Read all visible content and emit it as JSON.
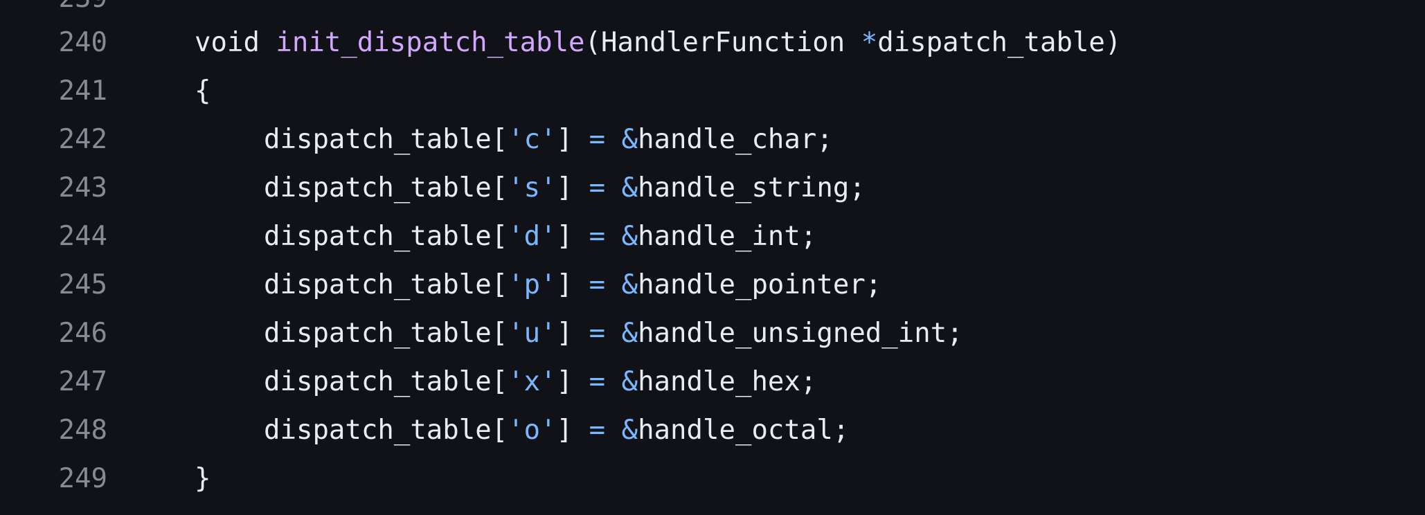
{
  "partial_top_line": "239",
  "lines": [
    {
      "num": "240",
      "parts": [
        "void",
        " ",
        "init_dispatch_table",
        "(HandlerFunction ",
        "*",
        "dispatch_table)"
      ]
    },
    {
      "num": "241",
      "parts": [
        "{"
      ]
    },
    {
      "num": "242",
      "parts": [
        "dispatch_table[",
        "'c'",
        "] ",
        "=",
        " ",
        "&",
        "handle_char;"
      ]
    },
    {
      "num": "243",
      "parts": [
        "dispatch_table[",
        "'s'",
        "] ",
        "=",
        " ",
        "&",
        "handle_string;"
      ]
    },
    {
      "num": "244",
      "parts": [
        "dispatch_table[",
        "'d'",
        "] ",
        "=",
        " ",
        "&",
        "handle_int;"
      ]
    },
    {
      "num": "245",
      "parts": [
        "dispatch_table[",
        "'p'",
        "] ",
        "=",
        " ",
        "&",
        "handle_pointer;"
      ]
    },
    {
      "num": "246",
      "parts": [
        "dispatch_table[",
        "'u'",
        "] ",
        "=",
        " ",
        "&",
        "handle_unsigned_int;"
      ]
    },
    {
      "num": "247",
      "parts": [
        "dispatch_table[",
        "'x'",
        "] ",
        "=",
        " ",
        "&",
        "handle_hex;"
      ]
    },
    {
      "num": "248",
      "parts": [
        "dispatch_table[",
        "'o'",
        "] ",
        "=",
        " ",
        "&",
        "handle_octal;"
      ]
    },
    {
      "num": "249",
      "parts": [
        "}"
      ]
    }
  ],
  "colors": {
    "background": "#111217",
    "line_number": "#858b94",
    "text": "#e6edf3",
    "function_name": "#d2a8ff",
    "operator": "#79b8ff",
    "char_literal": "#79b8ff"
  }
}
